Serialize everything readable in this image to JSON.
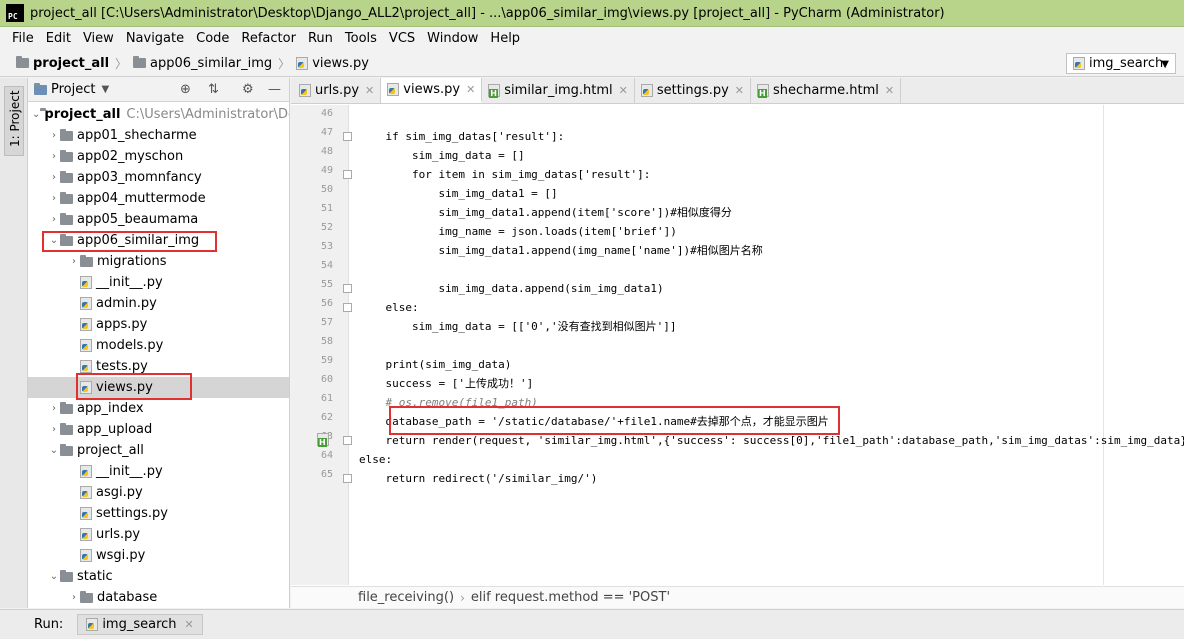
{
  "window": {
    "title": "project_all [C:\\Users\\Administrator\\Desktop\\Django_ALL2\\project_all] - ...\\app06_similar_img\\views.py [project_all] - PyCharm (Administrator)"
  },
  "menu": [
    "File",
    "Edit",
    "View",
    "Navigate",
    "Code",
    "Refactor",
    "Run",
    "Tools",
    "VCS",
    "Window",
    "Help"
  ],
  "breadcrumb": {
    "project": "project_all",
    "folder": "app06_similar_img",
    "file": "views.py"
  },
  "run_config": {
    "label": "img_search"
  },
  "left_strip": {
    "label": "1: Project"
  },
  "project_panel": {
    "title": "Project",
    "root": {
      "name": "project_all",
      "path": "C:\\Users\\Administrator\\De"
    },
    "items": [
      {
        "label": "app01_shecharme",
        "type": "folder",
        "arrow": "›"
      },
      {
        "label": "app02_myschon",
        "type": "folder",
        "arrow": "›"
      },
      {
        "label": "app03_momnfancy",
        "type": "folder",
        "arrow": "›"
      },
      {
        "label": "app04_muttermode",
        "type": "folder",
        "arrow": "›"
      },
      {
        "label": "app05_beaumama",
        "type": "folder",
        "arrow": "›"
      },
      {
        "label": "app06_similar_img",
        "type": "folder",
        "arrow": "⌄"
      },
      {
        "label": "migrations",
        "type": "folder",
        "arrow": "›"
      },
      {
        "label": "__init__.py",
        "type": "py",
        "arrow": ""
      },
      {
        "label": "admin.py",
        "type": "py",
        "arrow": ""
      },
      {
        "label": "apps.py",
        "type": "py",
        "arrow": ""
      },
      {
        "label": "models.py",
        "type": "py",
        "arrow": ""
      },
      {
        "label": "tests.py",
        "type": "py",
        "arrow": ""
      },
      {
        "label": "views.py",
        "type": "py",
        "arrow": ""
      },
      {
        "label": "app_index",
        "type": "folder",
        "arrow": "›"
      },
      {
        "label": "app_upload",
        "type": "folder",
        "arrow": "›"
      },
      {
        "label": "project_all",
        "type": "folder",
        "arrow": "⌄"
      },
      {
        "label": "__init__.py",
        "type": "py",
        "arrow": ""
      },
      {
        "label": "asgi.py",
        "type": "py",
        "arrow": ""
      },
      {
        "label": "settings.py",
        "type": "py",
        "arrow": ""
      },
      {
        "label": "urls.py",
        "type": "py",
        "arrow": ""
      },
      {
        "label": "wsgi.py",
        "type": "py",
        "arrow": ""
      },
      {
        "label": "static",
        "type": "folder",
        "arrow": "⌄"
      },
      {
        "label": "database",
        "type": "folder",
        "arrow": "›"
      }
    ]
  },
  "tabs": [
    {
      "label": "urls.py",
      "type": "py"
    },
    {
      "label": "views.py",
      "type": "py"
    },
    {
      "label": "similar_img.html",
      "type": "html"
    },
    {
      "label": "settings.py",
      "type": "py"
    },
    {
      "label": "shecharme.html",
      "type": "html"
    }
  ],
  "code_lines": [
    {
      "n": "46",
      "text": ""
    },
    {
      "n": "47",
      "text": "    if sim_img_datas['result']:"
    },
    {
      "n": "48",
      "text": "        sim_img_data = []"
    },
    {
      "n": "49",
      "text": "        for item in sim_img_datas['result']:"
    },
    {
      "n": "50",
      "text": "            sim_img_data1 = []"
    },
    {
      "n": "51",
      "text": "            sim_img_data1.append(item['score'])#相似度得分"
    },
    {
      "n": "52",
      "text": "            img_name = json.loads(item['brief'])"
    },
    {
      "n": "53",
      "text": "            sim_img_data1.append(img_name['name'])#相似图片名称"
    },
    {
      "n": "54",
      "text": ""
    },
    {
      "n": "55",
      "text": "            sim_img_data.append(sim_img_data1)"
    },
    {
      "n": "56",
      "text": "    else:"
    },
    {
      "n": "57",
      "text": "        sim_img_data = [['0','没有查找到相似图片']]"
    },
    {
      "n": "58",
      "text": ""
    },
    {
      "n": "59",
      "text": "    print(sim_img_data)"
    },
    {
      "n": "60",
      "text": "    success = ['上传成功！']"
    },
    {
      "n": "61",
      "text": "    # os.remove(file1_path)"
    },
    {
      "n": "62",
      "text": "    database_path = '/static/database/'+file1.name#去掉那个点，才能显示图片"
    },
    {
      "n": "63",
      "text": "    return render(request, 'similar_img.html',{'success': success[0],'file1_path':database_path,'sim_img_datas':sim_img_data})"
    },
    {
      "n": "64",
      "text": "else:"
    },
    {
      "n": "65",
      "text": "    return redirect('/similar_img/')"
    }
  ],
  "editor_breadcrumb": {
    "func": "file_receiving()",
    "branch": "elif request.method == 'POST'"
  },
  "run_bar": {
    "label": "Run:",
    "tab": "img_search"
  }
}
